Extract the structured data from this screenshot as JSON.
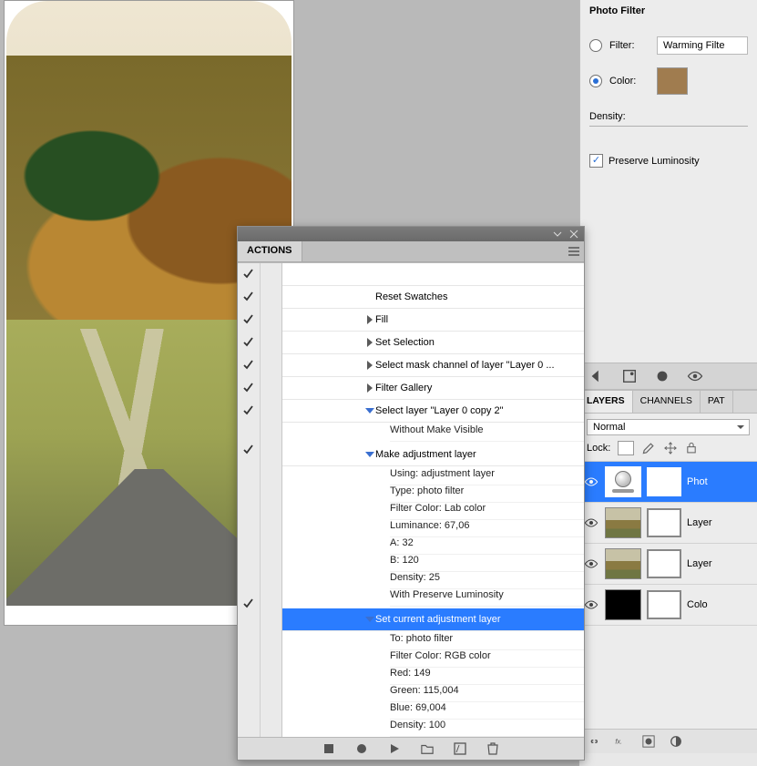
{
  "photo_filter": {
    "title": "Photo Filter",
    "filter_label": "Filter:",
    "filter_value": "Warming Filte",
    "color_label": "Color:",
    "color_hex": "#a07c4f",
    "density_label": "Density:",
    "preserve_label": "Preserve Luminosity",
    "mode": "color"
  },
  "layers_panel": {
    "tabs": [
      "LAYERS",
      "CHANNELS",
      "PAT"
    ],
    "active_tab": "LAYERS",
    "blend_mode": "Normal",
    "lock_label": "Lock:",
    "layers": [
      {
        "name": "Phot",
        "type": "adjustment",
        "selected": true
      },
      {
        "name": "Layer",
        "type": "image",
        "selected": false
      },
      {
        "name": "Layer",
        "type": "image",
        "selected": false
      },
      {
        "name": "Colo",
        "type": "solid-black",
        "selected": false
      }
    ]
  },
  "actions_panel": {
    "tab": "ACTIONS",
    "steps": [
      {
        "check": true,
        "dialog": false,
        "arrow": "none",
        "label": "",
        "visible_label": ""
      },
      {
        "check": true,
        "dialog": false,
        "arrow": "none",
        "label": "Reset Swatches"
      },
      {
        "check": true,
        "dialog": false,
        "arrow": "right",
        "label": "Fill"
      },
      {
        "check": true,
        "dialog": false,
        "arrow": "right",
        "label": "Set Selection"
      },
      {
        "check": true,
        "dialog": false,
        "arrow": "right",
        "label": "Select mask channel of layer \"Layer 0 ..."
      },
      {
        "check": true,
        "dialog": false,
        "arrow": "right",
        "label": "Filter Gallery"
      },
      {
        "check": true,
        "dialog": false,
        "arrow": "down",
        "label": "Select layer \"Layer 0 copy 2\"",
        "details": [
          "Without Make Visible"
        ]
      },
      {
        "check": true,
        "dialog": false,
        "arrow": "down",
        "label": "Make adjustment layer",
        "details": [
          "Using: adjustment layer",
          "Type: photo filter",
          "Filter Color: Lab color",
          "Luminance: 67,06",
          "A: 32",
          "B: 120",
          "Density: 25",
          "With Preserve Luminosity"
        ]
      },
      {
        "check": true,
        "dialog": false,
        "arrow": "down",
        "label": "Set current adjustment layer",
        "selected": true,
        "details": [
          "To: photo filter",
          "Filter Color: RGB color",
          "Red: 149",
          "Green: 115,004",
          "Blue: 69,004",
          "Density: 100"
        ]
      }
    ]
  }
}
